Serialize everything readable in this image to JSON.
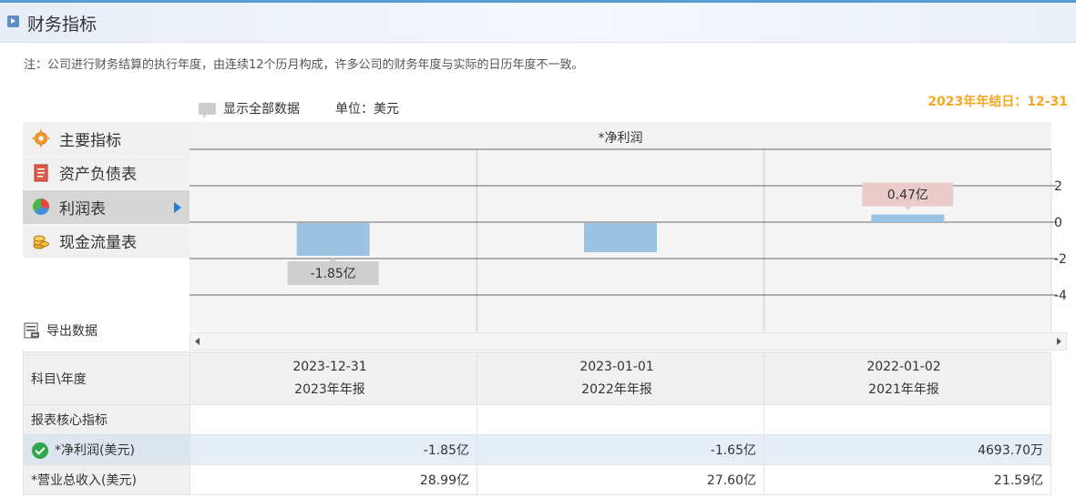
{
  "header": {
    "title": "财务指标"
  },
  "note": "注：公司进行财务结算的执行年度，由连续12个历月构成，许多公司的财务年度与实际的日历年度不一致。",
  "fiscal_year_end": "2023年年结日：12-31",
  "toolbar": {
    "show_all": "显示全部数据",
    "unit": "单位：美元"
  },
  "sidebar": {
    "items": [
      {
        "label": "主要指标",
        "icon": "gear-icon"
      },
      {
        "label": "资产负债表",
        "icon": "document-icon"
      },
      {
        "label": "利润表",
        "icon": "pie-chart-icon",
        "active": true
      },
      {
        "label": "现金流量表",
        "icon": "coins-icon"
      }
    ]
  },
  "export": {
    "label": "导出数据"
  },
  "chart_data": {
    "type": "bar",
    "title": "*净利润",
    "categories": [
      "2023-12-31",
      "2023-01-01",
      "2022-01-02"
    ],
    "series": [
      {
        "name": "*净利润",
        "values": [
          -1.85,
          -1.65,
          0.4694
        ],
        "value_labels": [
          "-1.85亿",
          "",
          "0.47亿"
        ]
      }
    ],
    "yticks": [
      2,
      0,
      -2,
      -4
    ],
    "ylim": [
      -6,
      4
    ],
    "grid": true,
    "colors": {
      "bar": "#9dc3e2",
      "negative_label_bg": "#cfcfcf",
      "positive_label_bg": "#ebcaca"
    }
  },
  "table": {
    "header_label": "科目\\年度",
    "columns": [
      {
        "date": "2023-12-31",
        "period": "2023年年报"
      },
      {
        "date": "2023-01-01",
        "period": "2022年年报"
      },
      {
        "date": "2022-01-02",
        "period": "2021年年报"
      }
    ],
    "rows": [
      {
        "label": "报表核心指标",
        "values": [
          "",
          "",
          ""
        ]
      },
      {
        "label": "*净利润(美元)",
        "values": [
          "-1.85亿",
          "-1.65亿",
          "4693.70万"
        ]
      },
      {
        "label": "*营业总收入(美元)",
        "values": [
          "28.99亿",
          "27.60亿",
          "21.59亿"
        ]
      }
    ]
  }
}
